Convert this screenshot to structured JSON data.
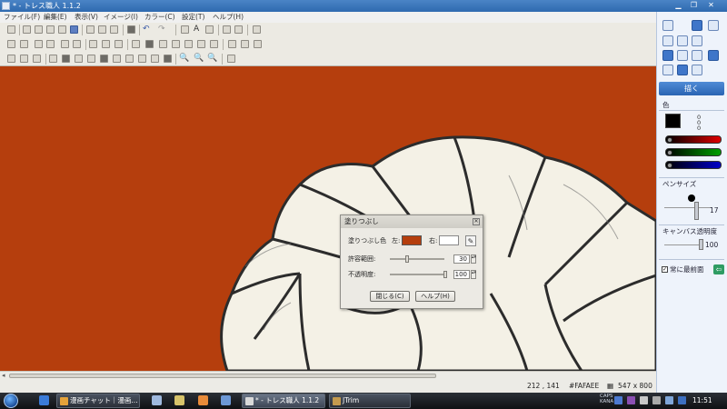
{
  "window": {
    "title": "* - トレス職人 1.1.2"
  },
  "menu": [
    "ファイル(F)",
    "編集(E)",
    "表示(V)",
    "イメージ(I)",
    "カラー(C)",
    "設定(T)",
    "ヘルプ(H)"
  ],
  "toolbar": {
    "undo_glyph": "↶",
    "redo_glyph": "↷",
    "text_tool": "A",
    "zoom_glyphs": [
      "🔍",
      "🔍",
      "🔍"
    ]
  },
  "canvas": {
    "background": "#b53e0d"
  },
  "status": {
    "coords": "212 , 141",
    "color_hex": "#FAFAEE",
    "size": "547 x 800"
  },
  "panel": {
    "draw_button": "描く",
    "color_label": "色",
    "color_values": [
      "0",
      "0",
      "0"
    ],
    "pen_size_label": "ペンサイズ",
    "pen_size_value": "17",
    "canvas_opacity_label": "キャンバス透明度",
    "canvas_opacity_value": "100",
    "front_label": "常に最前面",
    "front_checked": "✓"
  },
  "dialog": {
    "title": "塗りつぶし",
    "fill_color_label": "塗りつぶし色",
    "left_label": "左:",
    "right_label": "右:",
    "fill_left_color": "#b53e0d",
    "fill_right_color": "#ffffff",
    "tolerance_label": "許容範囲:",
    "tolerance_value": "30",
    "opacity_label": "不透明度:",
    "opacity_value": "100",
    "close_button": "閉じる(C)",
    "help_button": "ヘルプ(H)"
  },
  "taskbar": {
    "tasks": [
      "漫画チャット｜漫画...",
      "* - トレス職人 1.1.2",
      "JTrim"
    ],
    "clock": "11:51",
    "lang_lines": [
      "CAPS",
      "KANA"
    ]
  }
}
